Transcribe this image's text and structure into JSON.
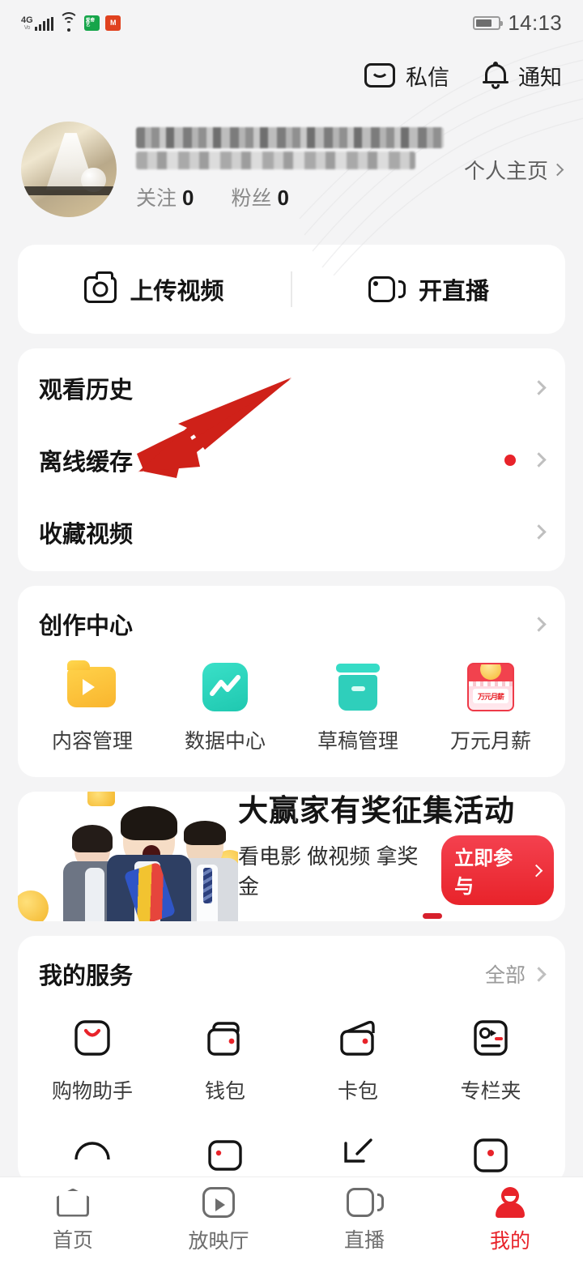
{
  "status_bar": {
    "network_type": "4G",
    "network_sub": "Vo",
    "time": "14:13",
    "battery_percent": 72,
    "app_badge_1": "爱奇艺",
    "app_badge_2": "M"
  },
  "header": {
    "message_label": "私信",
    "notification_label": "通知"
  },
  "profile": {
    "username_masked": "",
    "following_label": "关注",
    "following_count": "0",
    "followers_label": "粉丝",
    "followers_count": "0",
    "home_link": "个人主页"
  },
  "quick_actions": [
    {
      "label": "上传视频",
      "icon": "camera-icon"
    },
    {
      "label": "开直播",
      "icon": "live-camera-icon"
    }
  ],
  "menu": [
    {
      "label": "观看历史",
      "badge": false
    },
    {
      "label": "离线缓存",
      "badge": true
    },
    {
      "label": "收藏视频",
      "badge": false
    }
  ],
  "creation_center": {
    "title": "创作中心",
    "items": [
      {
        "label": "内容管理",
        "icon": "folder-play-icon"
      },
      {
        "label": "数据中心",
        "icon": "line-chart-icon"
      },
      {
        "label": "草稿管理",
        "icon": "archive-box-icon"
      },
      {
        "label": "万元月薪",
        "icon": "calendar-reward-icon",
        "icon_text": "万元月薪"
      }
    ]
  },
  "banner": {
    "title": "大赢家有奖征集活动",
    "subtitle": "看电影 做视频 拿奖金",
    "cta": "立即参与"
  },
  "services": {
    "title": "我的服务",
    "more_label": "全部",
    "items": [
      {
        "label": "购物助手",
        "icon": "shopping-bag-icon",
        "badge": false
      },
      {
        "label": "钱包",
        "icon": "wallet-icon",
        "badge": true
      },
      {
        "label": "卡包",
        "icon": "card-holder-icon",
        "badge": true
      },
      {
        "label": "专栏夹",
        "icon": "column-folder-icon",
        "badge": true
      }
    ]
  },
  "bottom_nav": [
    {
      "label": "首页",
      "icon": "home-icon",
      "active": false
    },
    {
      "label": "放映厅",
      "icon": "play-screen-icon",
      "active": false
    },
    {
      "label": "直播",
      "icon": "live-icon",
      "active": false
    },
    {
      "label": "我的",
      "icon": "profile-icon",
      "active": true
    }
  ],
  "annotation": {
    "type": "arrow",
    "color": "#cf2119",
    "points_to": "离线缓存"
  },
  "colors": {
    "page_bg": "#f4f4f5",
    "card_bg": "#ffffff",
    "accent_red": "#e8232a",
    "text_primary": "#141414",
    "text_secondary": "#8a8a8a"
  }
}
